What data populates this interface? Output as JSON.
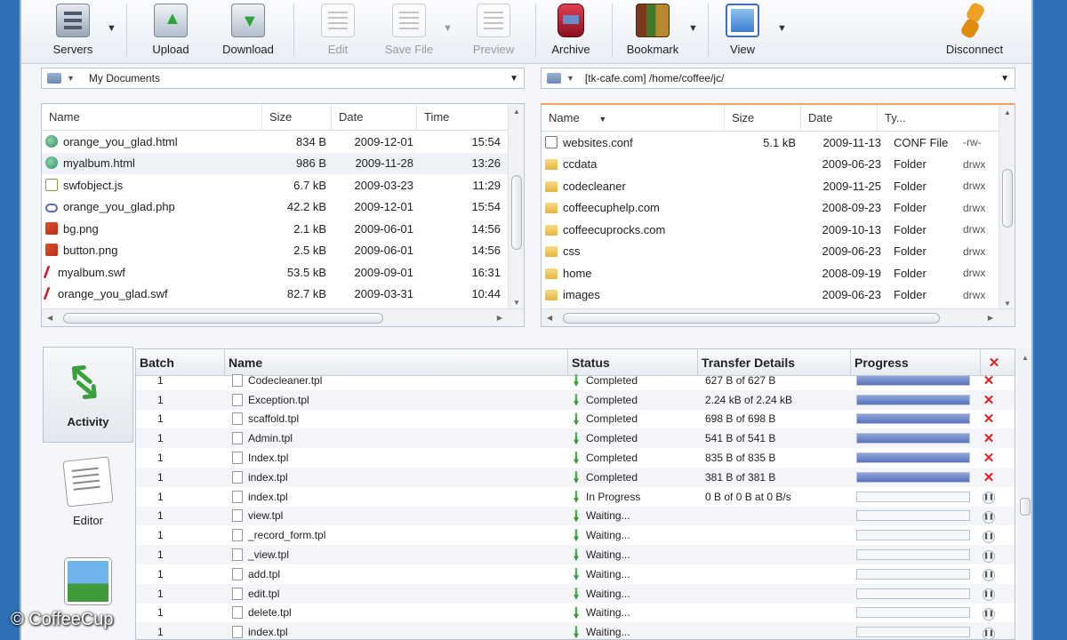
{
  "toolbar": {
    "servers": "Servers",
    "upload": "Upload",
    "download": "Download",
    "edit": "Edit",
    "save_file": "Save File",
    "preview": "Preview",
    "archive": "Archive",
    "bookmark": "Bookmark",
    "view": "View",
    "disconnect": "Disconnect"
  },
  "local": {
    "path": "My Documents",
    "columns": [
      "Name",
      "Size",
      "Date",
      "Time"
    ],
    "files": [
      {
        "name": "orange_you_glad.html",
        "size": "834 B",
        "date": "2009-12-01",
        "time": "15:54",
        "icon": "html-icon"
      },
      {
        "name": "myalbum.html",
        "size": "986 B",
        "date": "2009-11-28",
        "time": "13:26",
        "icon": "html-icon"
      },
      {
        "name": "swfobject.js",
        "size": "6.7 kB",
        "date": "2009-03-23",
        "time": "11:29",
        "icon": "js-icon"
      },
      {
        "name": "orange_you_glad.php",
        "size": "42.2 kB",
        "date": "2009-12-01",
        "time": "15:54",
        "icon": "php-icon"
      },
      {
        "name": "bg.png",
        "size": "2.1 kB",
        "date": "2009-06-01",
        "time": "14:56",
        "icon": "png-icon"
      },
      {
        "name": "button.png",
        "size": "2.5 kB",
        "date": "2009-06-01",
        "time": "14:56",
        "icon": "png-icon"
      },
      {
        "name": "myalbum.swf",
        "size": "53.5 kB",
        "date": "2009-09-01",
        "time": "16:31",
        "icon": "swf-icon"
      },
      {
        "name": "orange_you_glad.swf",
        "size": "82.7 kB",
        "date": "2009-03-31",
        "time": "10:44",
        "icon": "swf-icon"
      }
    ]
  },
  "remote": {
    "path": "[tk-cafe.com] /home/coffee/jc/",
    "columns": [
      "Name",
      "Size",
      "Date",
      "Ty..."
    ],
    "files": [
      {
        "name": "websites.conf",
        "size": "5.1 kB",
        "date": "2009-11-13",
        "type": "CONF File",
        "perm": "-rw-",
        "icon": "conf-icon"
      },
      {
        "name": "ccdata",
        "size": "",
        "date": "2009-06-23",
        "type": "Folder",
        "perm": "drwx",
        "icon": "folder-icon"
      },
      {
        "name": "codecleaner",
        "size": "",
        "date": "2009-11-25",
        "type": "Folder",
        "perm": "drwx",
        "icon": "folder-icon"
      },
      {
        "name": "coffeecuphelp.com",
        "size": "",
        "date": "2008-09-23",
        "type": "Folder",
        "perm": "drwx",
        "icon": "folder-icon"
      },
      {
        "name": "coffeecuprocks.com",
        "size": "",
        "date": "2009-10-13",
        "type": "Folder",
        "perm": "drwx",
        "icon": "folder-icon"
      },
      {
        "name": "css",
        "size": "",
        "date": "2009-06-23",
        "type": "Folder",
        "perm": "drwx",
        "icon": "folder-icon"
      },
      {
        "name": "home",
        "size": "",
        "date": "2008-09-19",
        "type": "Folder",
        "perm": "drwx",
        "icon": "folder-icon"
      },
      {
        "name": "images",
        "size": "",
        "date": "2009-06-23",
        "type": "Folder",
        "perm": "drwx",
        "icon": "folder-icon"
      }
    ]
  },
  "side_tabs": {
    "activity": "Activity",
    "editor": "Editor"
  },
  "queue": {
    "columns": [
      "Batch",
      "Name",
      "Status",
      "Transfer Details",
      "Progress"
    ],
    "rows": [
      {
        "batch": "1",
        "name": "Codecleaner.tpl",
        "status": "Completed",
        "detail": "627 B of 627 B",
        "progress": 100,
        "action": "cancel"
      },
      {
        "batch": "1",
        "name": "Exception.tpl",
        "status": "Completed",
        "detail": "2.24 kB of 2.24 kB",
        "progress": 100,
        "action": "cancel"
      },
      {
        "batch": "1",
        "name": "scaffold.tpl",
        "status": "Completed",
        "detail": "698 B of 698 B",
        "progress": 100,
        "action": "cancel"
      },
      {
        "batch": "1",
        "name": "Admin.tpl",
        "status": "Completed",
        "detail": "541 B of 541 B",
        "progress": 100,
        "action": "cancel"
      },
      {
        "batch": "1",
        "name": "Index.tpl",
        "status": "Completed",
        "detail": "835 B of 835 B",
        "progress": 100,
        "action": "cancel"
      },
      {
        "batch": "1",
        "name": "index.tpl",
        "status": "Completed",
        "detail": "381 B of 381 B",
        "progress": 100,
        "action": "cancel"
      },
      {
        "batch": "1",
        "name": "index.tpl",
        "status": "In Progress",
        "detail": "0 B of   0 B at   0 B/s",
        "progress": 0,
        "action": "pause"
      },
      {
        "batch": "1",
        "name": "view.tpl",
        "status": "Waiting...",
        "detail": "",
        "progress": 0,
        "action": "pause"
      },
      {
        "batch": "1",
        "name": "_record_form.tpl",
        "status": "Waiting...",
        "detail": "",
        "progress": 0,
        "action": "pause"
      },
      {
        "batch": "1",
        "name": "_view.tpl",
        "status": "Waiting...",
        "detail": "",
        "progress": 0,
        "action": "pause"
      },
      {
        "batch": "1",
        "name": "add.tpl",
        "status": "Waiting...",
        "detail": "",
        "progress": 0,
        "action": "pause"
      },
      {
        "batch": "1",
        "name": "edit.tpl",
        "status": "Waiting...",
        "detail": "",
        "progress": 0,
        "action": "pause"
      },
      {
        "batch": "1",
        "name": "delete.tpl",
        "status": "Waiting...",
        "detail": "",
        "progress": 0,
        "action": "pause"
      },
      {
        "batch": "1",
        "name": "index.tpl",
        "status": "Waiting...",
        "detail": "",
        "progress": 0,
        "action": "pause"
      }
    ]
  },
  "watermark": "© CoffeeCup"
}
